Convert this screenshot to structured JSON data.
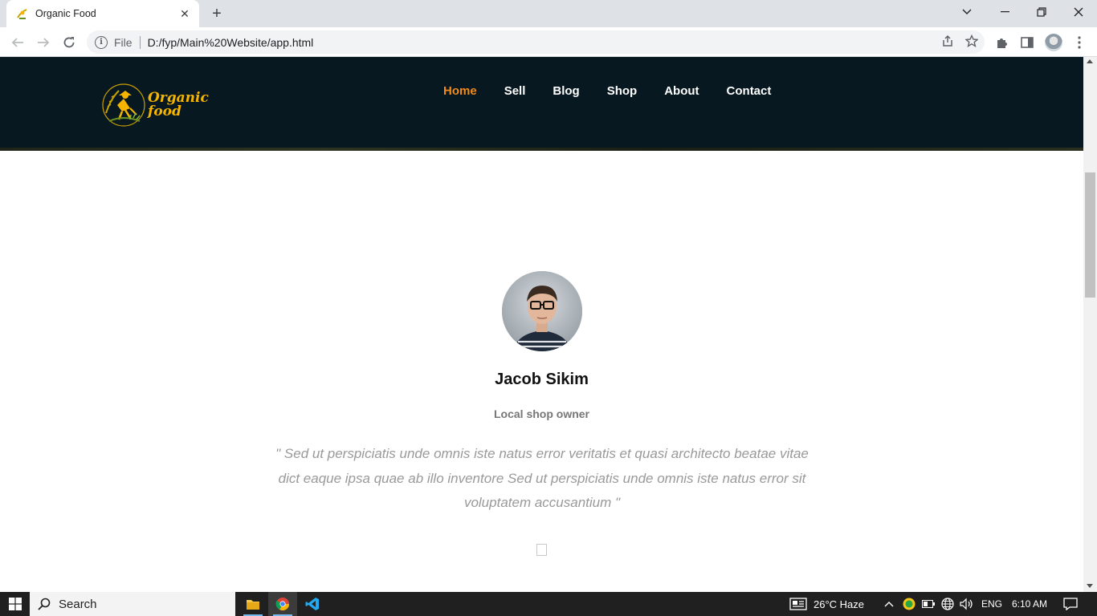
{
  "browser": {
    "tab_title": "Organic Food",
    "scheme_label": "File",
    "url": "D:/fyp/Main%20Website/app.html"
  },
  "site": {
    "logo_line1": "Organic",
    "logo_line2": "food",
    "nav": [
      {
        "label": "Home",
        "active": true
      },
      {
        "label": "Sell",
        "active": false
      },
      {
        "label": "Blog",
        "active": false
      },
      {
        "label": "Shop",
        "active": false
      },
      {
        "label": "About",
        "active": false
      },
      {
        "label": "Contact",
        "active": false
      }
    ]
  },
  "testimonial": {
    "name": "Jacob Sikim",
    "role": "Local shop owner",
    "quote": "\" Sed ut perspiciatis unde omnis iste natus error veritatis et quasi architecto beatae vitae dict eaque ipsa quae ab illo inventore Sed ut perspiciatis unde omnis iste natus error sit voluptatem accusantium \""
  },
  "taskbar": {
    "search_label": "Search",
    "weather": "26°C  Haze",
    "language": "ENG",
    "time": "6:10 AM"
  },
  "colors": {
    "header_bg": "#081820",
    "nav_active": "#f28b1c",
    "logo_gold": "#f5b400"
  }
}
